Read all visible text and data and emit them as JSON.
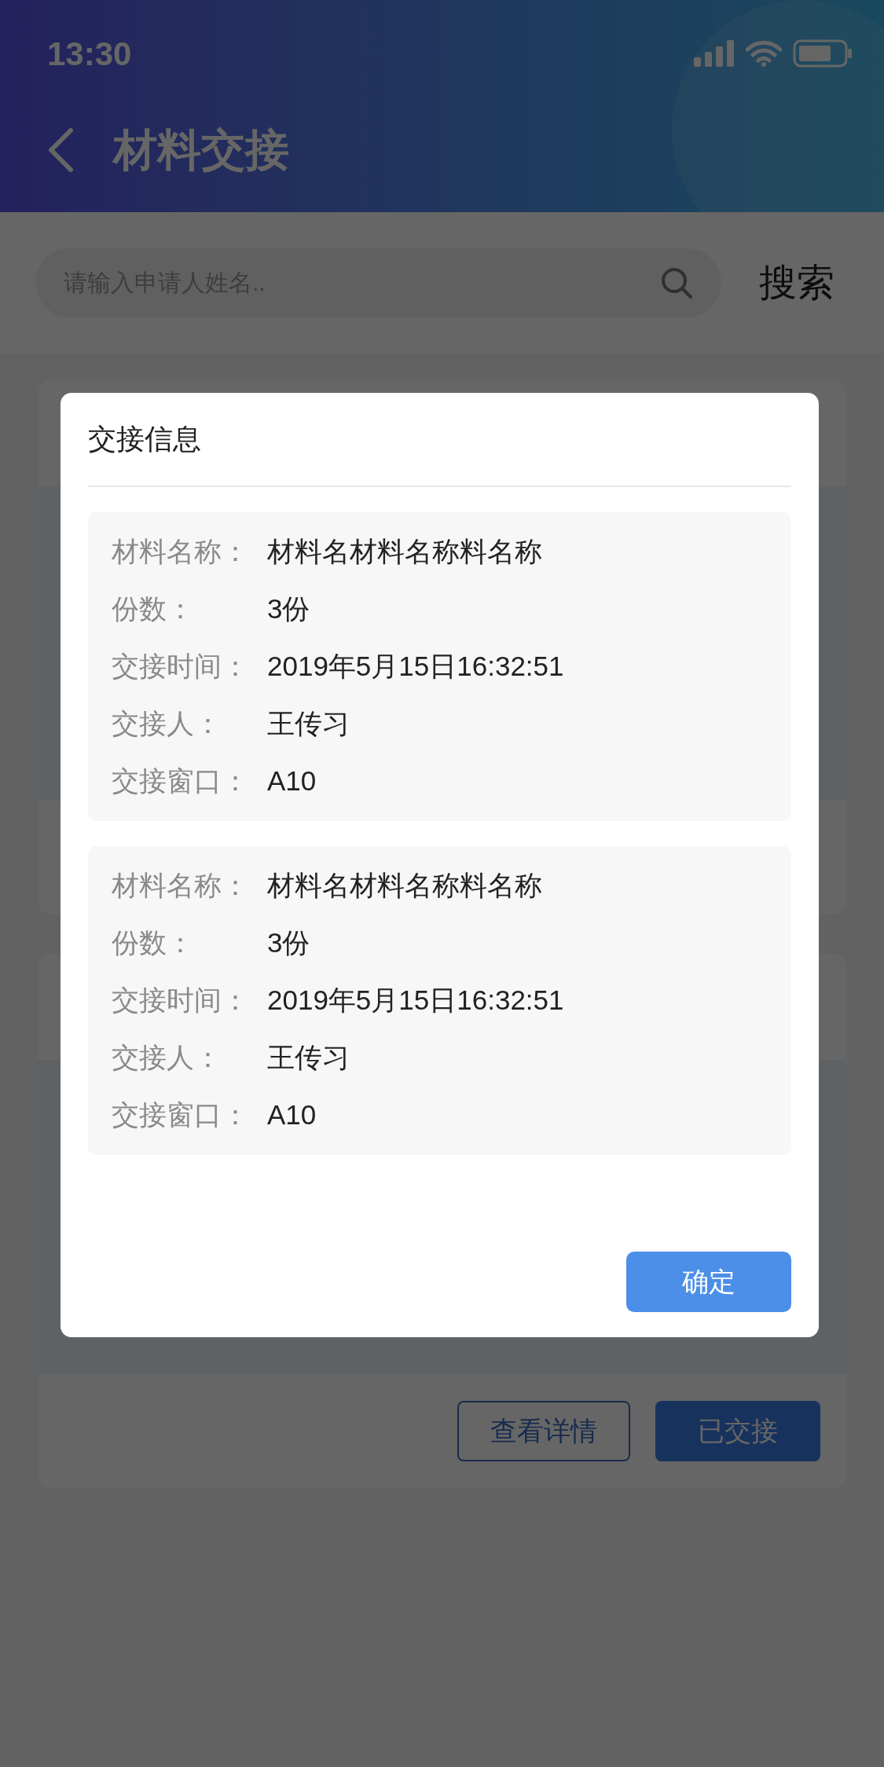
{
  "status_bar": {
    "time": "13:30"
  },
  "header": {
    "title": "材料交接"
  },
  "search": {
    "placeholder": "请输入申请人姓名..",
    "button": "搜索"
  },
  "record_card": {
    "buttons": [
      {
        "label": "查看详情",
        "kind": "outline"
      },
      {
        "label": "已交接",
        "kind": "filled"
      }
    ]
  },
  "dialog": {
    "title": "交接信息",
    "items": [
      {
        "fields": [
          {
            "label": "材料名称：",
            "value": "材料名材料名称料名称"
          },
          {
            "label": "份数：",
            "value": "3份"
          },
          {
            "label": "交接时间：",
            "value": "2019年5月15日16:32:51"
          },
          {
            "label": "交接人：",
            "value": "王传习"
          },
          {
            "label": "交接窗口：",
            "value": "A10"
          }
        ]
      },
      {
        "fields": [
          {
            "label": "材料名称：",
            "value": "材料名材料名称料名称"
          },
          {
            "label": "份数：",
            "value": "3份"
          },
          {
            "label": "交接时间：",
            "value": "2019年5月15日16:32:51"
          },
          {
            "label": "交接人：",
            "value": "王传习"
          },
          {
            "label": "交接窗口：",
            "value": "A10"
          }
        ]
      }
    ],
    "confirm": "确定"
  }
}
